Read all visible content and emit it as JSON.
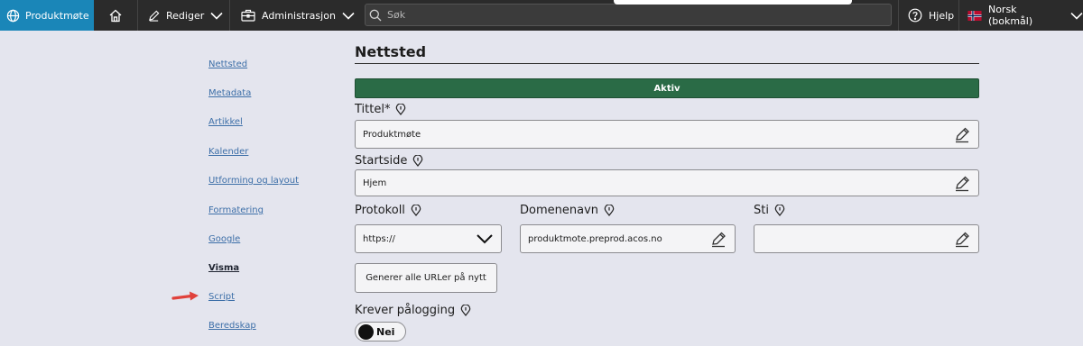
{
  "topbar": {
    "brand": "Produktmøte",
    "edit": "Rediger",
    "admin": "Administrasjon",
    "search_placeholder": "Søk",
    "help": "Hjelp",
    "language": "Norsk (bokmål)"
  },
  "sidebar": {
    "items": [
      {
        "label": "Nettsted"
      },
      {
        "label": "Metadata"
      },
      {
        "label": "Artikkel"
      },
      {
        "label": "Kalender"
      },
      {
        "label": "Utforming og layout"
      },
      {
        "label": "Formatering"
      },
      {
        "label": "Google"
      },
      {
        "label": "Visma"
      },
      {
        "label": "Script"
      },
      {
        "label": "Beredskap"
      }
    ]
  },
  "main": {
    "heading": "Nettsted",
    "status": "Aktiv",
    "title_label": "Tittel*",
    "title_value": "Produktmøte",
    "start_label": "Startside",
    "start_value": "Hjem",
    "protocol_label": "Protokoll",
    "protocol_value": "https://",
    "domain_label": "Domenenavn",
    "domain_value": "produktmote.preprod.acos.no",
    "path_label": "Sti",
    "path_value": "",
    "regen_button": "Generer alle URLer på nytt",
    "login_label": "Krever pålogging",
    "login_toggle": "Nei"
  },
  "colors": {
    "brand_bg": "#1a86b8",
    "topbar_bg": "#2b2b2b",
    "status_bg": "#2a6b46",
    "link": "#3d6fa8",
    "arrow": "#e0413b"
  }
}
